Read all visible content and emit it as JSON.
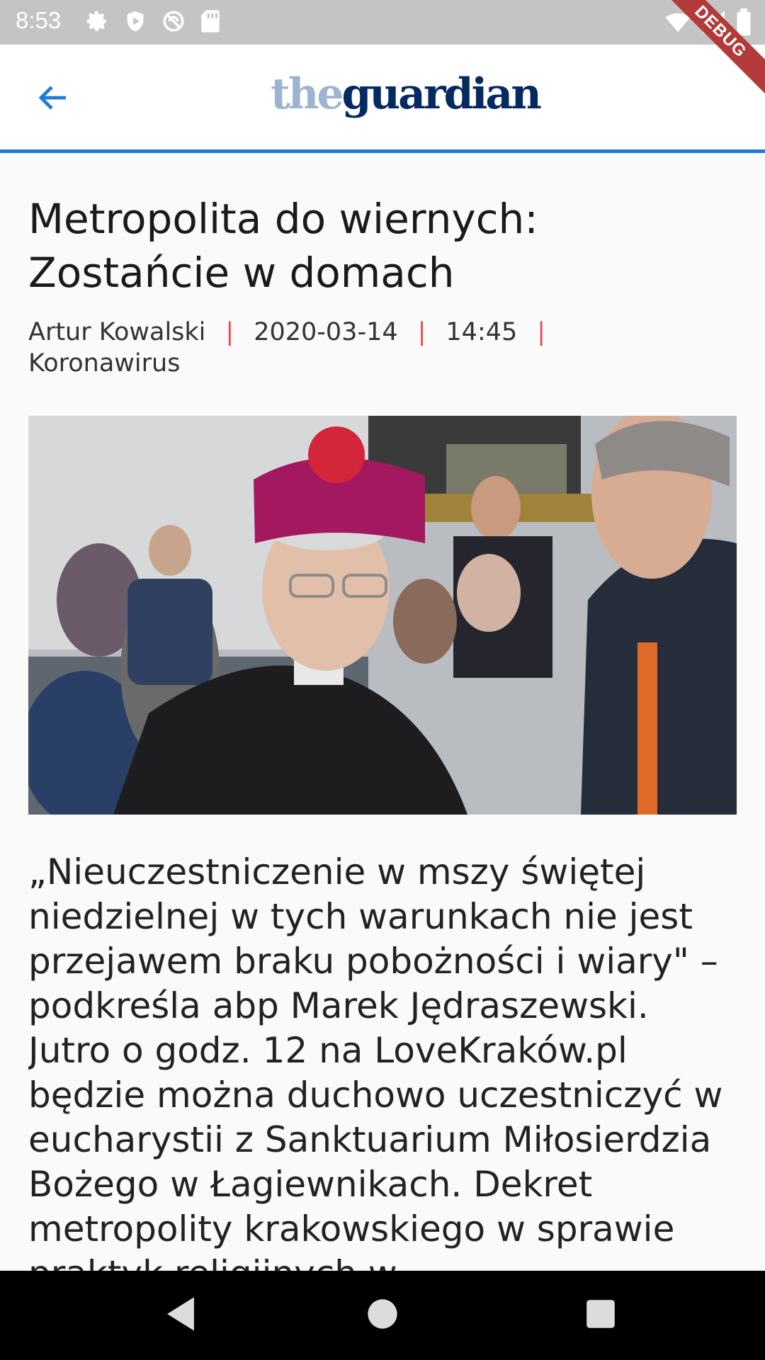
{
  "status_bar": {
    "time": "8:53",
    "icons": [
      "gear-icon",
      "shield-play-icon",
      "sync-icon",
      "sd-card-icon"
    ],
    "right_icons": [
      "wifi-icon",
      "cell-signal-icon",
      "battery-icon"
    ],
    "debug_label": "DEBUG"
  },
  "app_bar": {
    "logo_the": "the",
    "logo_guardian": "guardian",
    "accent_color": "#1f7ae0"
  },
  "article": {
    "title": "Metropolita do wiernych: Zostańcie w domach",
    "author": "Artur Kowalski",
    "date": "2020-03-14",
    "time": "14:45",
    "separator": "|",
    "category": "Koronawirus",
    "image_name": "article-photo",
    "body": "„Nieuczestniczenie w mszy świętej niedzielnej w tych warunkach nie jest przejawem braku pobożności i wiary\" – podkreśla abp Marek Jędraszewski. Jutro o godz. 12 na LoveKraków.pl będzie można duchowo uczestniczyć w eucharystii z Sanktuarium Miłosierdzia Bożego w Łagiewnikach. Dekret metropolity krakowskiego w sprawie praktyk religijnych w"
  },
  "nav_bar": {
    "buttons": [
      "back-triangle-icon",
      "home-circle-icon",
      "recents-square-icon"
    ]
  }
}
